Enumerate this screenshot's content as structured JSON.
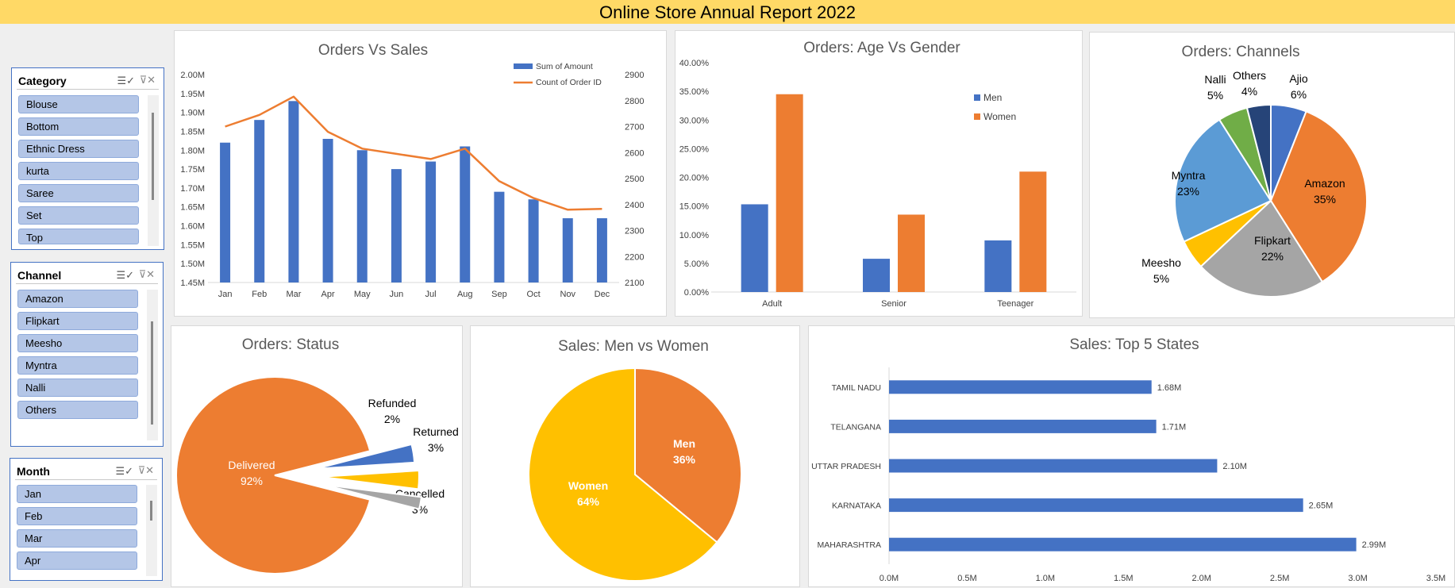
{
  "report_title": "Online Store Annual Report 2022",
  "slicers": {
    "category": {
      "title": "Category",
      "items": [
        "Blouse",
        "Bottom",
        "Ethnic Dress",
        "kurta",
        "Saree",
        "Set",
        "Top"
      ]
    },
    "channel": {
      "title": "Channel",
      "items": [
        "Amazon",
        "Flipkart",
        "Meesho",
        "Myntra",
        "Nalli",
        "Others"
      ]
    },
    "month": {
      "title": "Month",
      "items": [
        "Jan",
        "Feb",
        "Mar",
        "Apr"
      ]
    },
    "icons": {
      "multi_select": "multi-select-icon",
      "clear_filter": "clear-filter-icon"
    }
  },
  "colors": {
    "blue": "#4472c4",
    "orange": "#ed7d31",
    "gray": "#a5a5a5",
    "yellow": "#ffc000",
    "light_blue": "#5b9bd5",
    "green": "#70ad47",
    "navy": "#264478",
    "title_bar": "#ffd966"
  },
  "chart_data": [
    {
      "id": "orders_vs_sales",
      "type": "bar",
      "title": "Orders Vs Sales",
      "categories": [
        "Jan",
        "Feb",
        "Mar",
        "Apr",
        "May",
        "Jun",
        "Jul",
        "Aug",
        "Sep",
        "Oct",
        "Nov",
        "Dec"
      ],
      "series": [
        {
          "name": "Sum of Amount",
          "type": "bar",
          "axis": "left",
          "labels": [
            "1.82M",
            "1.88M",
            "1.93M",
            "1.83M",
            "1.80M",
            "1.75M",
            "1.77M",
            "1.81M",
            "1.69M",
            "1.67M",
            "1.62M",
            "1.62M"
          ],
          "values": [
            1.82,
            1.88,
            1.93,
            1.83,
            1.8,
            1.75,
            1.77,
            1.81,
            1.69,
            1.67,
            1.62,
            1.62
          ]
        },
        {
          "name": "Count of Order ID",
          "type": "line",
          "axis": "right",
          "values": [
            2700,
            2745,
            2815,
            2680,
            2615,
            2595,
            2575,
            2615,
            2490,
            2425,
            2380,
            2383
          ]
        }
      ],
      "y_left_ticks": [
        "2.00M",
        "1.95M",
        "1.90M",
        "1.85M",
        "1.80M",
        "1.75M",
        "1.70M",
        "1.65M",
        "1.60M",
        "1.55M",
        "1.50M",
        "1.45M"
      ],
      "ylim_left": [
        1.45,
        2.0
      ],
      "y_right_ticks": [
        "2900",
        "2800",
        "2700",
        "2600",
        "2500",
        "2400",
        "2300",
        "2200",
        "2100"
      ],
      "ylim_right": [
        2100,
        2900
      ],
      "legend": "top-right"
    },
    {
      "id": "orders_age_gender",
      "type": "bar",
      "title": "Orders: Age Vs Gender",
      "categories": [
        "Adult",
        "Senior",
        "Teenager"
      ],
      "series": [
        {
          "name": "Men",
          "values": [
            15.3,
            5.8,
            9.0
          ]
        },
        {
          "name": "Women",
          "values": [
            34.5,
            13.5,
            21.0
          ]
        }
      ],
      "y_ticks": [
        "40.00%",
        "35.00%",
        "30.00%",
        "25.00%",
        "20.00%",
        "15.00%",
        "10.00%",
        "5.00%",
        "0.00%"
      ],
      "ylim": [
        0,
        40
      ],
      "legend": "top-right"
    },
    {
      "id": "orders_channels",
      "type": "pie",
      "title": "Orders: Channels",
      "slices": [
        {
          "label": "Ajio",
          "pct": "6%",
          "value": 6
        },
        {
          "label": "Amazon",
          "pct": "35%",
          "value": 35
        },
        {
          "label": "Flipkart",
          "pct": "22%",
          "value": 22
        },
        {
          "label": "Meesho",
          "pct": "5%",
          "value": 5
        },
        {
          "label": "Myntra",
          "pct": "23%",
          "value": 23
        },
        {
          "label": "Nalli",
          "pct": "5%",
          "value": 5
        },
        {
          "label": "Others",
          "pct": "4%",
          "value": 4
        }
      ]
    },
    {
      "id": "orders_status",
      "type": "pie",
      "title": "Orders: Status",
      "slices": [
        {
          "label": "Delivered",
          "pct": "92%",
          "value": 92
        },
        {
          "label": "Cancelled",
          "pct": "3%",
          "value": 3
        },
        {
          "label": "Returned",
          "pct": "3%",
          "value": 3
        },
        {
          "label": "Refunded",
          "pct": "2%",
          "value": 2
        }
      ]
    },
    {
      "id": "sales_men_women",
      "type": "pie",
      "title": "Sales: Men vs Women",
      "slices": [
        {
          "label": "Men",
          "pct": "36%",
          "value": 36
        },
        {
          "label": "Women",
          "pct": "64%",
          "value": 64
        }
      ]
    },
    {
      "id": "sales_top_states",
      "type": "bar",
      "orientation": "horizontal",
      "title": "Sales: Top 5 States",
      "categories": [
        "TAMIL NADU",
        "TELANGANA",
        "UTTAR PRADESH",
        "KARNATAKA",
        "MAHARASHTRA"
      ],
      "values": [
        1.68,
        1.71,
        2.1,
        2.65,
        2.99
      ],
      "labels": [
        "1.68M",
        "1.71M",
        "2.10M",
        "2.65M",
        "2.99M"
      ],
      "x_ticks": [
        "0.0M",
        "0.5M",
        "1.0M",
        "1.5M",
        "2.0M",
        "2.5M",
        "3.0M",
        "3.5M"
      ],
      "xlim": [
        0,
        3.5
      ]
    }
  ]
}
